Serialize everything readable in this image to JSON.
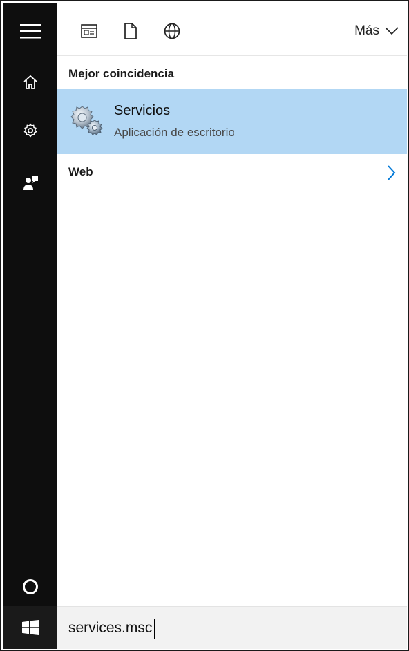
{
  "toolbar": {
    "icons": [
      "apps-icon",
      "document-icon",
      "globe-icon"
    ],
    "more_label": "Más"
  },
  "results": {
    "best_match_heading": "Mejor coincidencia",
    "best_match": {
      "title": "Servicios",
      "subtitle": "Aplicación de escritorio",
      "icon": "services-gears-icon"
    },
    "web_heading": "Web"
  },
  "search": {
    "value": "services.msc"
  },
  "colors": {
    "rail_bg": "#0e0e0e",
    "highlight": "#b2d7f4",
    "accent": "#0078d7"
  }
}
